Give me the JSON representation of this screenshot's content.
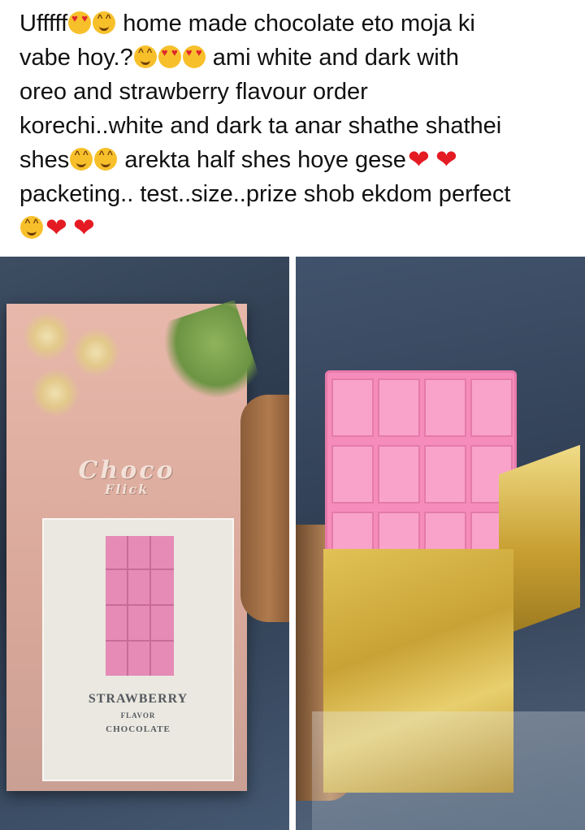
{
  "post": {
    "lines": [
      [
        {
          "text": "Ufffff"
        },
        {
          "emoji": "heart-eyes-icon"
        },
        {
          "emoji": "smile-icon"
        },
        {
          "text": " home made chocolate eto moja ki"
        }
      ],
      [
        {
          "text": "vabe hoy.?"
        },
        {
          "emoji": "smile-icon"
        },
        {
          "emoji": "heart-eyes-icon"
        },
        {
          "emoji": "heart-eyes-icon"
        },
        {
          "text": " ami white and dark with"
        }
      ],
      [
        {
          "text": "oreo and strawberry flavour order"
        }
      ],
      [
        {
          "text": "korechi..white and dark ta anar shathe shathei"
        }
      ],
      [
        {
          "text": "shes"
        },
        {
          "emoji": "smile-icon"
        },
        {
          "emoji": "smile-icon"
        },
        {
          "text": " arekta half shes hoye gese"
        },
        {
          "emoji": "heart-icon"
        },
        {
          "emoji": "heart-icon"
        }
      ],
      [
        {
          "text": "packeting.. test..size..prize shob ekdom perfect"
        }
      ],
      [
        {
          "emoji": "smile-icon"
        },
        {
          "emoji": "heart-icon"
        },
        {
          "emoji": "heart-icon"
        }
      ]
    ]
  },
  "photo_left": {
    "brand_line1": "Choco",
    "brand_line2": "Flick",
    "label_line1": "STRAWBERRY",
    "label_line2": "FLAVOR",
    "label_line3": "CHOCOLATE"
  },
  "colors": {
    "text": "#111111",
    "box_pink": "#d9a89a",
    "bar_pink": "#f58cbb",
    "gold_foil": "#c9a235",
    "denim": "#2f3d52"
  }
}
